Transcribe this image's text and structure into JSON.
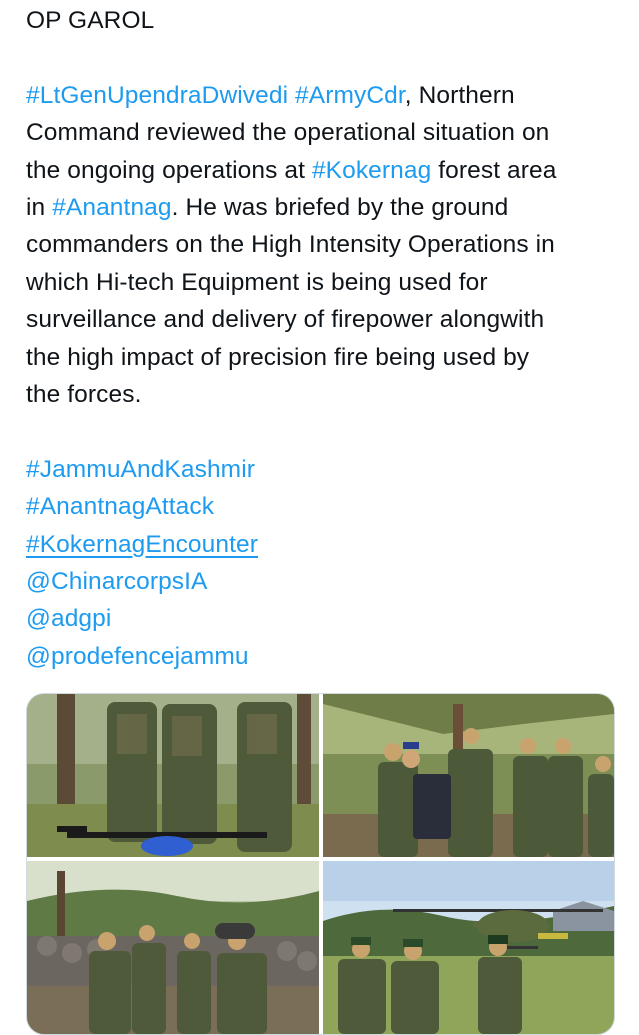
{
  "post": {
    "title": "OP GAROL",
    "body": {
      "line1": {
        "tag1": "#LtGenUpendraDwivedi",
        "sep": " ",
        "tag2": "#ArmyCdr",
        "rest": ", Northern"
      },
      "line2": "Command reviewed the operational situation on",
      "line3": {
        "pre": "the ongoing operations at ",
        "tag": "#Kokernag",
        "post": " forest area"
      },
      "line4": {
        "pre": "in ",
        "tag": "#Anantnag",
        "post": ". He was briefed by the ground"
      },
      "line5": "commanders on the High Intensity Operations in",
      "line6": "which Hi-tech Equipment is being used for",
      "line7": "surveillance and delivery of firepower alongwith",
      "line8": "the high impact of precision fire being used by",
      "line9": "the forces."
    },
    "hashtags": [
      "#JammuAndKashmir",
      "#AnantnagAttack",
      "#KokernagEncounter"
    ],
    "mentions": [
      "@ChinarcorpsIA",
      "@adgpi",
      "@prodefencejammu"
    ]
  },
  "media": {
    "photos": [
      {
        "icon": "photo-drone-inspection"
      },
      {
        "icon": "photo-officers-briefing"
      },
      {
        "icon": "photo-soldiers-bunker"
      },
      {
        "icon": "photo-helicopter-field"
      }
    ]
  },
  "colors": {
    "text": "#0f1419",
    "link": "#1d9bf0",
    "border": "#cfd9de"
  }
}
